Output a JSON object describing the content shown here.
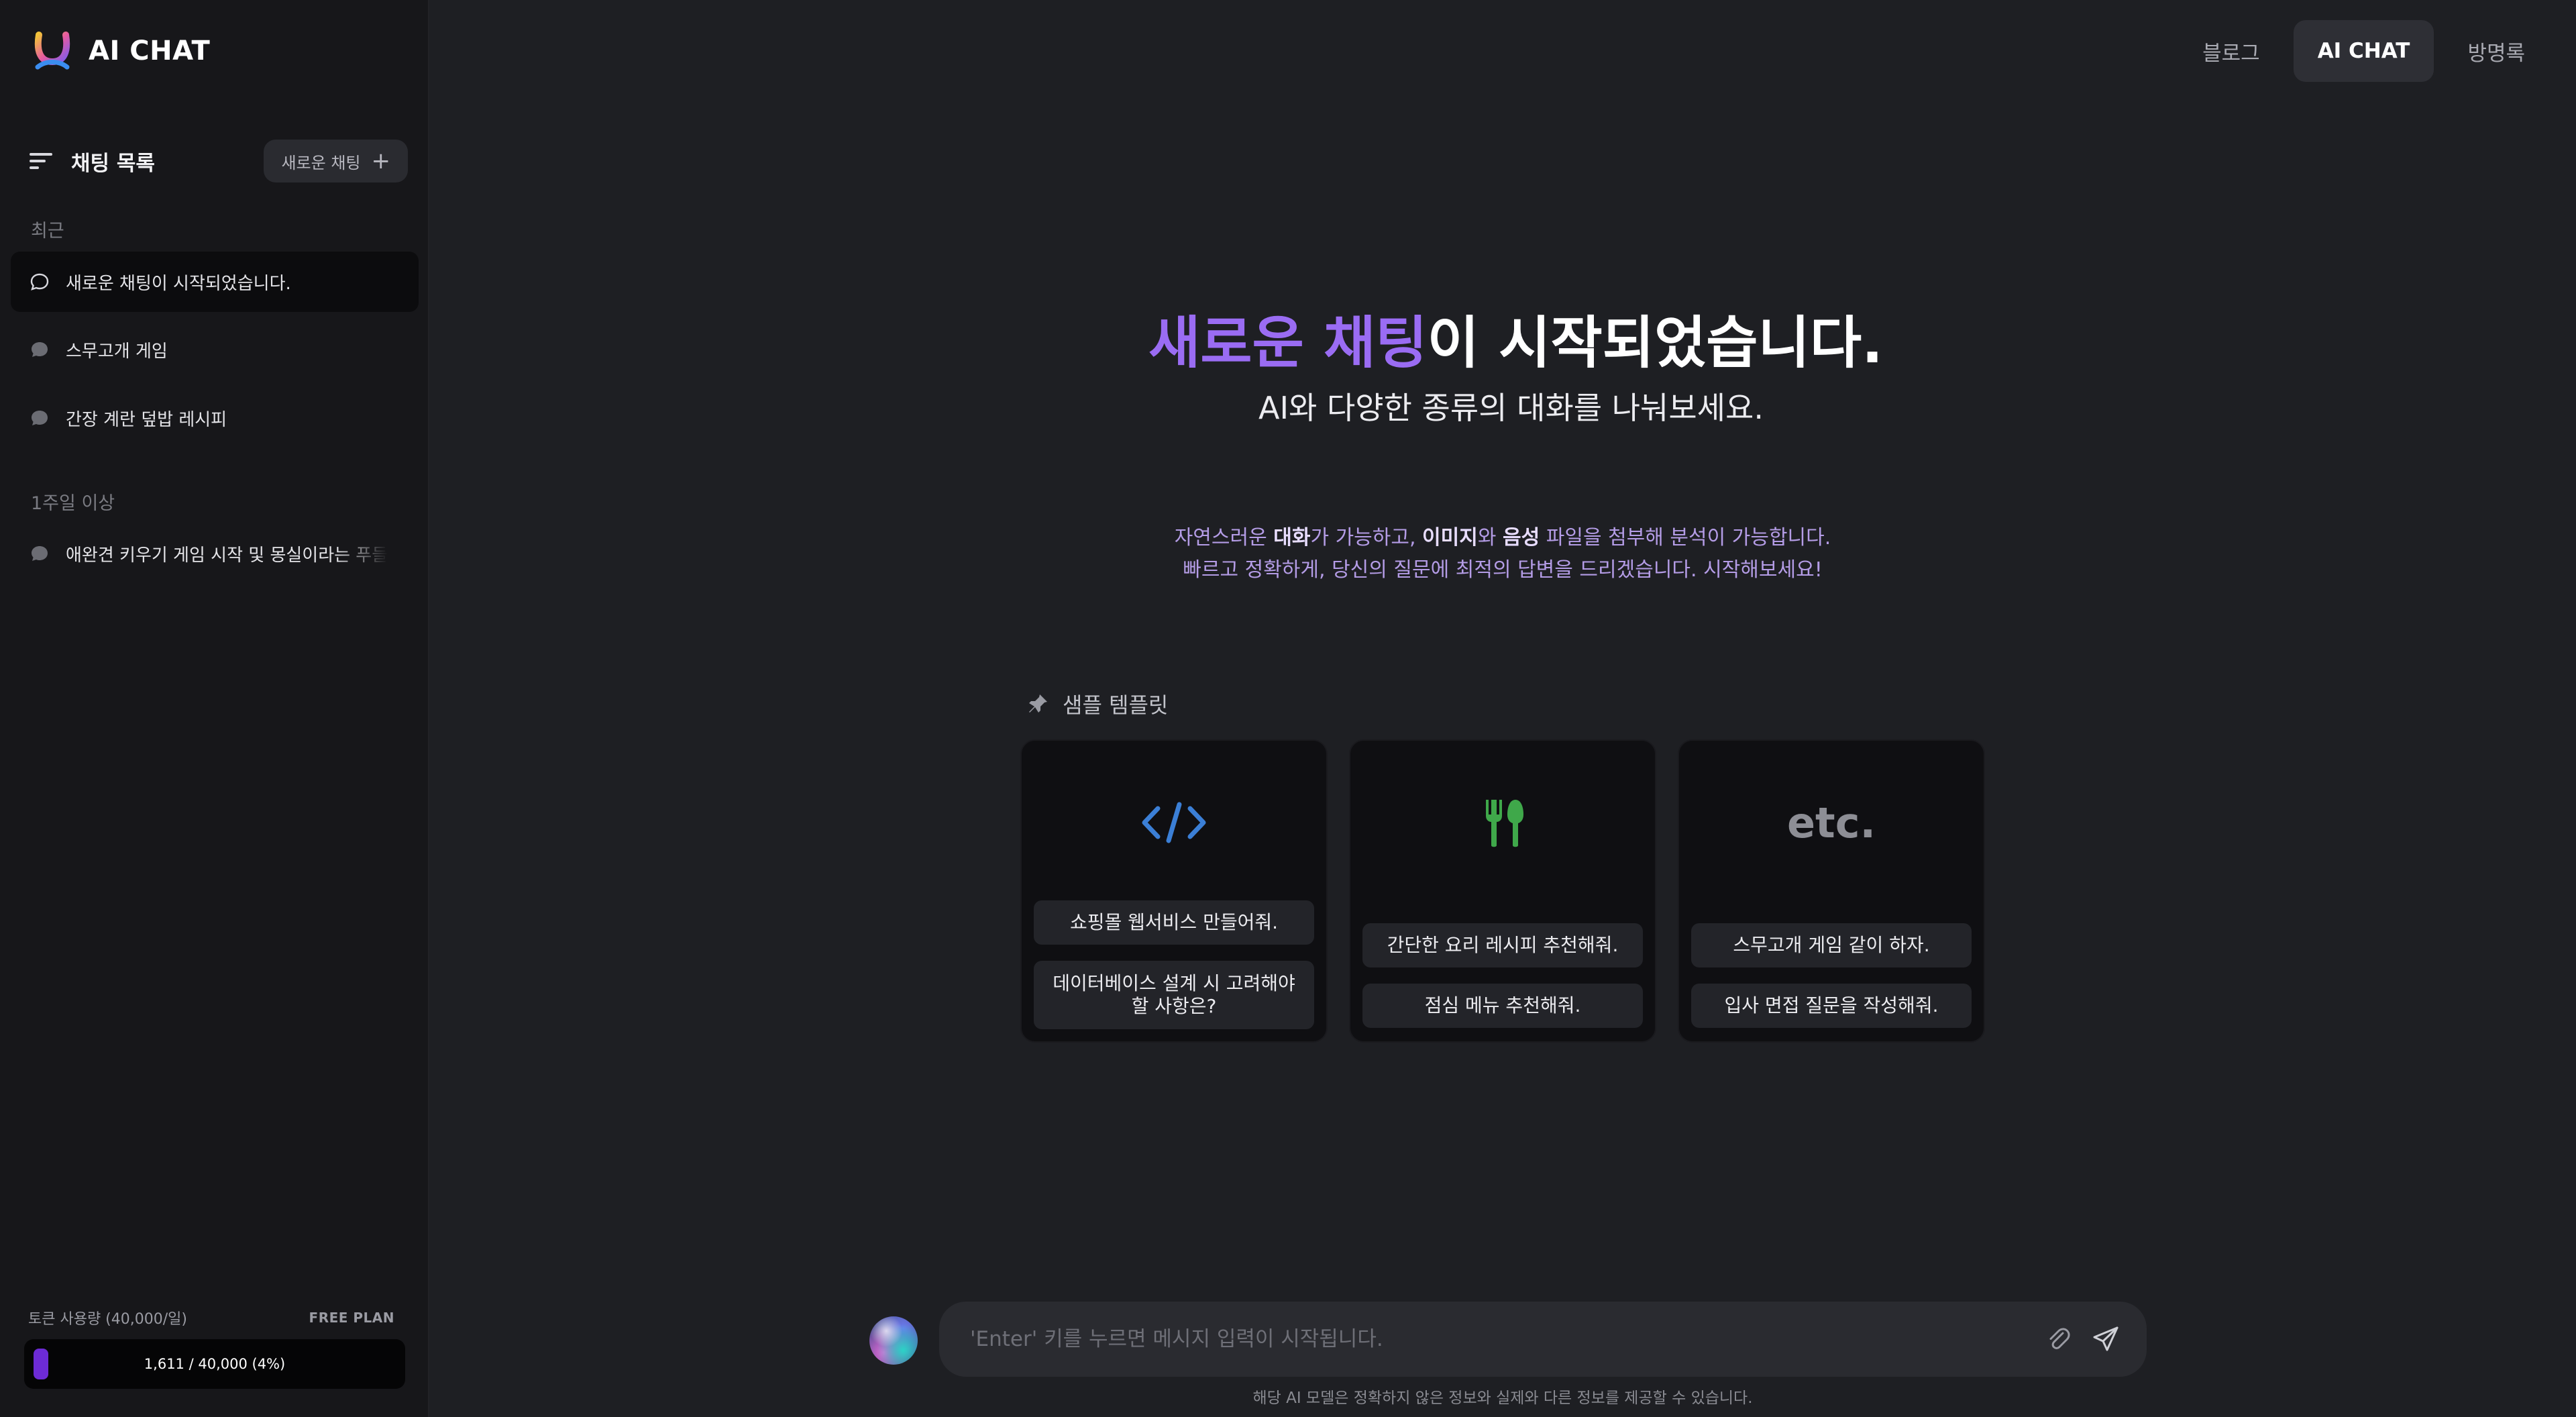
{
  "app": {
    "title": "AI CHAT"
  },
  "topnav": {
    "items": [
      {
        "label": "블로그",
        "active": false
      },
      {
        "label": "AI CHAT",
        "active": true
      },
      {
        "label": "방명록",
        "active": false
      }
    ]
  },
  "sidebar": {
    "list_title": "채팅 목록",
    "new_chat_label": "새로운 채팅",
    "sections": [
      {
        "label": "최근",
        "items": [
          {
            "label": "새로운 채팅이 시작되었습니다.",
            "active": true
          },
          {
            "label": "스무고개 게임",
            "active": false
          },
          {
            "label": "간장 계란 덮밥 레시피",
            "active": false
          }
        ]
      },
      {
        "label": "1주일 이상",
        "items": [
          {
            "label": "애완견 키우기 게임 시작 및 몽실이라는 푸들",
            "active": false
          }
        ]
      }
    ],
    "usage": {
      "label": "토큰 사용량 (40,000/일)",
      "plan": "FREE PLAN",
      "text": "1,611 / 40,000 (4%)",
      "used": 1611,
      "limit": 40000,
      "fraction": 0.04
    }
  },
  "hero": {
    "title_accent": "새로운 채팅",
    "title_rest": "이 시작되었습니다.",
    "subtitle": "AI와 다양한 종류의 대화를 나눠보세요.",
    "desc1": {
      "a": "자연스러운 ",
      "b": "대화",
      "c": "가 가능하고, ",
      "d": "이미지",
      "e": "와 ",
      "f": "음성",
      "g": " 파일을 첨부해 분석이 가능합니다."
    },
    "desc2": "빠르고 정확하게, 당신의 질문에 최적의 답변을 드리겠습니다. 시작해보세요!"
  },
  "templates": {
    "label": "샘플 템플릿",
    "cards": [
      {
        "icon": "code-icon",
        "icon_color": "#3b7fd6",
        "prompts": [
          "쇼핑몰 웹서비스 만들어줘.",
          "데이터베이스 설계 시 고려해야 할 사항은?"
        ]
      },
      {
        "icon": "fork-knife-icon",
        "icon_color": "#3fa84a",
        "prompts": [
          "간단한 요리 레시피 추천해줘.",
          "점심 메뉴 추천해줘."
        ]
      },
      {
        "icon": "etc-text-icon",
        "icon_text": "etc.",
        "prompts": [
          "스무고개 게임 같이 하자.",
          "입사 면접 질문을 작성해줘."
        ]
      }
    ]
  },
  "input": {
    "placeholder": "'Enter' 키를 누르면 메시지 입력이 시작됩니다.",
    "disclaimer": "해당 AI 모델은 정확하지 않은 정보와 실제와 다른 정보를 제공할 수 있습니다."
  },
  "colors": {
    "accent": "#9a6cf3",
    "usage_fill": "#6d2bd6",
    "background": "#1e1f23",
    "sidebar": "#17171a"
  }
}
